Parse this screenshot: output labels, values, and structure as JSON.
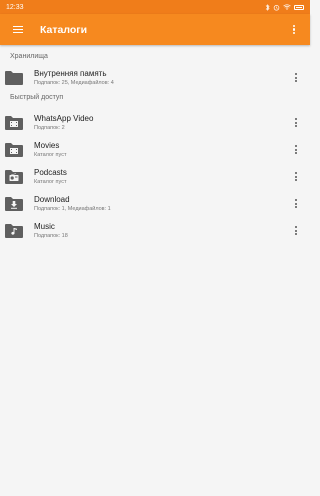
{
  "status": {
    "time": "12:33"
  },
  "toolbar": {
    "title": "Каталоги"
  },
  "sections": {
    "storage_header": "Хранилища",
    "quick_header": "Быстрый доступ"
  },
  "storage": [
    {
      "name": "Внутренняя память",
      "sub": "Подпапок: 25, Медиафайлов: 4",
      "icon": "folder-icon"
    }
  ],
  "quick": [
    {
      "name": "WhatsApp Video",
      "sub": "Подпапок: 2",
      "icon": "video-folder-icon"
    },
    {
      "name": "Movies",
      "sub": "Каталог пуст",
      "icon": "video-folder-icon"
    },
    {
      "name": "Podcasts",
      "sub": "Каталог пуст",
      "icon": "radio-folder-icon"
    },
    {
      "name": "Download",
      "sub": "Подпапок: 1, Медиафайлов: 1",
      "icon": "download-folder-icon"
    },
    {
      "name": "Music",
      "sub": "Подпапок: 18",
      "icon": "music-folder-icon"
    }
  ],
  "colors": {
    "status_bar": "#f07d1a",
    "toolbar": "#f6891f",
    "background": "#f5f5f5",
    "folder": "#5f5f5f"
  }
}
